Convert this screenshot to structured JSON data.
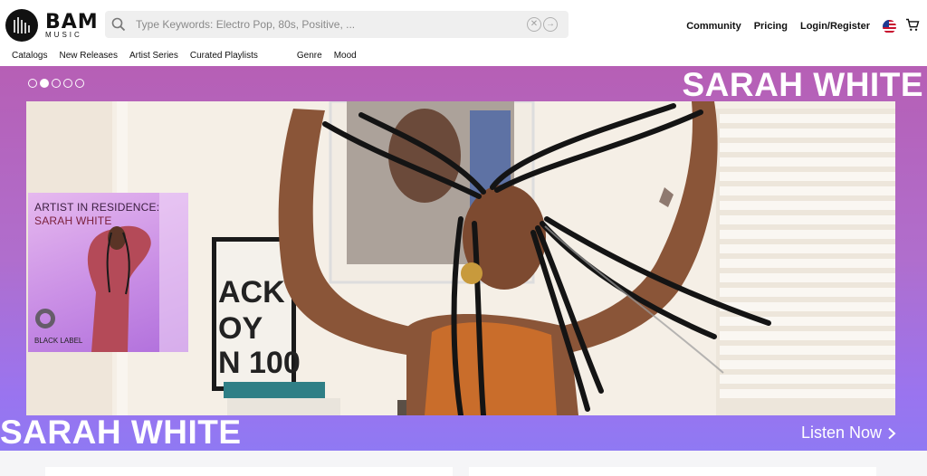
{
  "header": {
    "logo_text": "BAM",
    "logo_subtext": "MUSIC",
    "search_placeholder": "Type Keywords: Electro Pop, 80s, Positive, ...",
    "nav": [
      {
        "label": "Community"
      },
      {
        "label": "Pricing"
      },
      {
        "label": "Login/Register"
      }
    ]
  },
  "subnav": {
    "items": [
      {
        "label": "Catalogs"
      },
      {
        "label": "New Releases"
      },
      {
        "label": "Artist Series"
      },
      {
        "label": "Curated Playlists"
      }
    ],
    "filters": [
      {
        "label": "Genre"
      },
      {
        "label": "Mood"
      }
    ]
  },
  "hero": {
    "title_top": "SARAH WHITE",
    "title_bottom": "SARAH WHITE",
    "listen_label": "Listen Now",
    "slide_count": 5,
    "active_slide": 2,
    "card": {
      "line1": "ARTIST IN RESIDENCE:",
      "line2": "SARAH WHITE",
      "label": "BLACK LABEL"
    },
    "poster_text": [
      "ACK",
      "OY",
      "N 100"
    ]
  },
  "icons": {
    "search": "search-icon",
    "clear": "clear-icon",
    "go": "arrow-right-circle-icon",
    "flag": "us-flag-icon",
    "cart": "cart-icon",
    "chevron": "chevron-right-icon"
  },
  "colors": {
    "hero_top": "#b65fb5",
    "hero_bottom": "#8f79f3"
  }
}
